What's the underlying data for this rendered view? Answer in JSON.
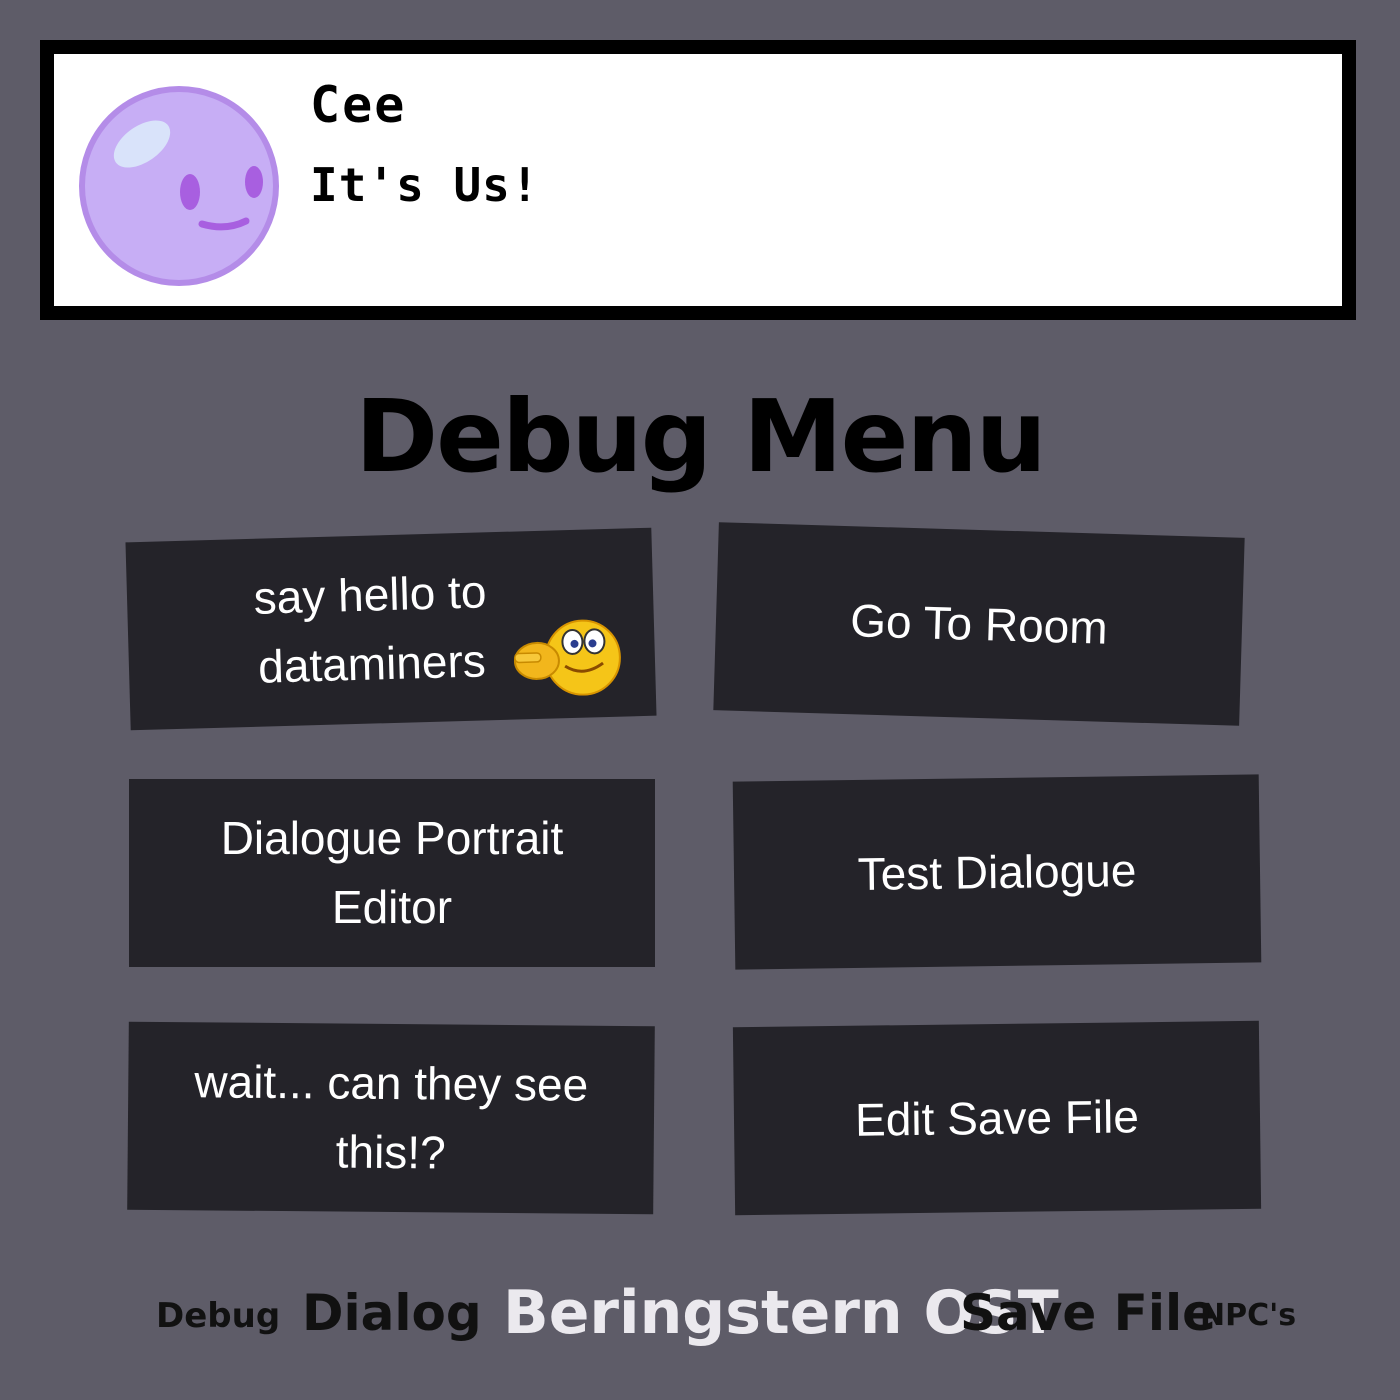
{
  "dialogue": {
    "speaker": "Cee",
    "text": "It's Us!"
  },
  "title": "Debug Menu",
  "buttons": [
    {
      "label": "say hello to dataminers"
    },
    {
      "label": "Go To Room"
    },
    {
      "label": "Dialogue Portrait Editor"
    },
    {
      "label": "Test Dialogue"
    },
    {
      "label": "wait... can they see this!?"
    },
    {
      "label": "Edit Save File"
    }
  ],
  "nav": [
    {
      "label": "Debug"
    },
    {
      "label": "Dialog"
    },
    {
      "label": "Beringstern OST"
    },
    {
      "label": "Save File"
    },
    {
      "label": "NPC's"
    }
  ],
  "colors": {
    "background": "#5e5c68",
    "button": "#242329",
    "portrait": "#c7aef5",
    "active_nav": "#ebe9ee"
  },
  "icons": [
    "cee-portrait-icon",
    "pointing-smiley-emoji-icon"
  ]
}
